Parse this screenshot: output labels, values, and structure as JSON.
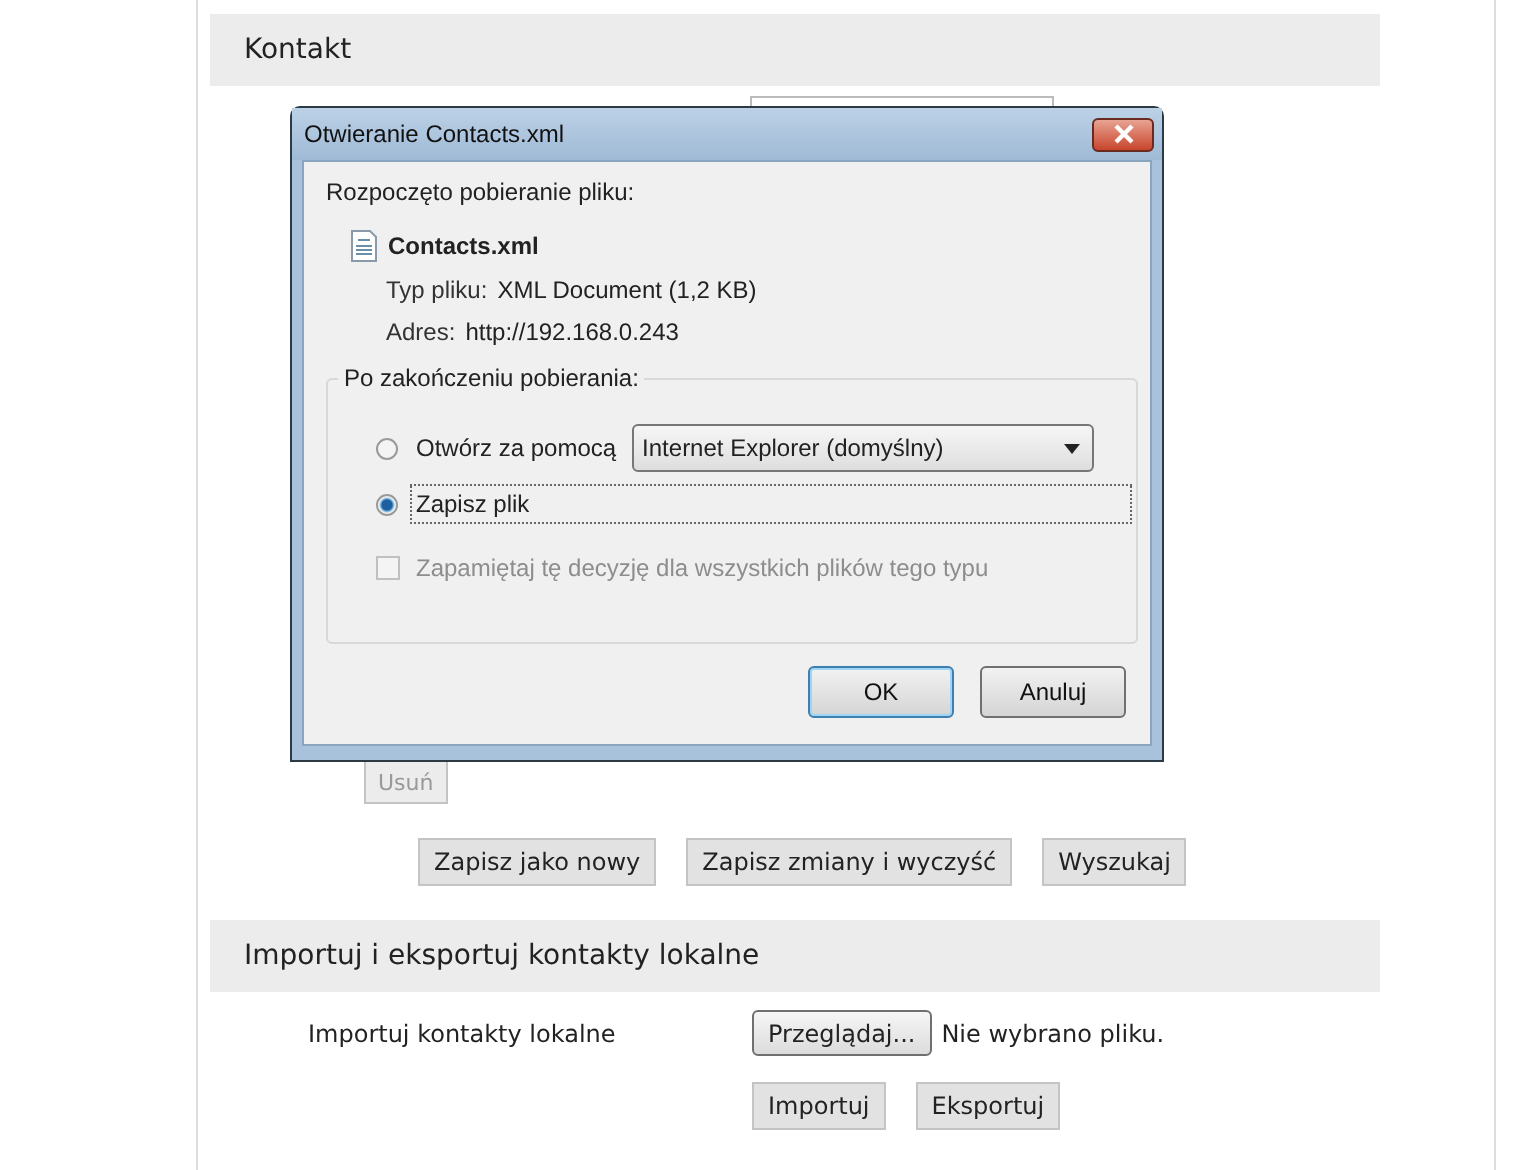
{
  "contact_section": {
    "title": "Kontakt",
    "delete_button": {
      "label": "Usuń",
      "disabled": true
    },
    "buttons": [
      "Zapisz jako nowy",
      "Zapisz zmiany i wyczyść",
      "Wyszukaj"
    ]
  },
  "import_export_section": {
    "title": "Importuj i eksportuj kontakty lokalne",
    "import_label": "Importuj kontakty lokalne",
    "browse_button": "Przeglądaj...",
    "file_status": "Nie wybrano pliku.",
    "buttons": [
      "Importuj",
      "Eksportuj"
    ]
  },
  "dialog": {
    "title": "Otwieranie Contacts.xml",
    "intro": "Rozpoczęto pobieranie pliku:",
    "file_name": "Contacts.xml",
    "file_type_label": "Typ pliku:",
    "file_type": "XML Document (1,2 KB)",
    "address_label": "Adres:",
    "address": "http://192.168.0.243",
    "group_title": "Po zakończeniu pobierania:",
    "options": [
      {
        "label": "Otwórz za pomocą",
        "selected": false,
        "kind": "open-with",
        "app": "Internet Explorer (domyślny)"
      },
      {
        "label": "Zapisz plik",
        "selected": true,
        "kind": "save"
      }
    ],
    "remember": {
      "label": "Zapamiętaj tę decyzję dla wszystkich plików tego typu",
      "checked": false,
      "disabled": true
    },
    "buttons": [
      "OK",
      "Anuluj"
    ]
  }
}
